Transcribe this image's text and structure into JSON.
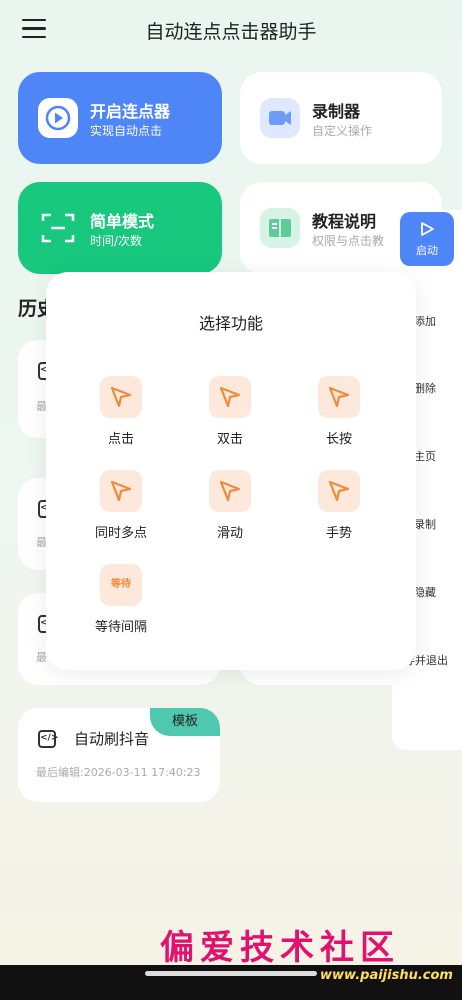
{
  "header": {
    "title": "自动连点点击器助手"
  },
  "cards": {
    "autoclick": {
      "title": "开启连点器",
      "subtitle": "实现自动点击"
    },
    "recorder": {
      "title": "录制器",
      "subtitle": "自定义操作"
    },
    "simple": {
      "title": "简单模式",
      "subtitle": "时间/次数"
    },
    "tutorial": {
      "title": "教程说明",
      "subtitle": "权限与点击教"
    }
  },
  "history": {
    "title": "历史",
    "items": [
      {
        "name": "自动刷抖音",
        "last_edit": "最后编辑:2026-03-11 17:40:23",
        "badge": "模板"
      }
    ],
    "partial_last_edit": "最"
  },
  "float_panel": {
    "start_label": "启动",
    "items": [
      "添加",
      "删除",
      "主页",
      "录制",
      "隐藏",
      "存并退出"
    ]
  },
  "sheet": {
    "title": "选择功能",
    "functions": [
      "点击",
      "双击",
      "长按",
      "同时多点",
      "滑动",
      "手势",
      "等待间隔"
    ],
    "wait_icon_text": "等待"
  },
  "watermark": {
    "text": "偏爱技术社区",
    "url": "www.paijishu.com"
  },
  "colors": {
    "blue": "#4f86f7",
    "green": "#17c87e",
    "accent_orange": "#f08a3c",
    "teal": "#4ec9b0"
  }
}
